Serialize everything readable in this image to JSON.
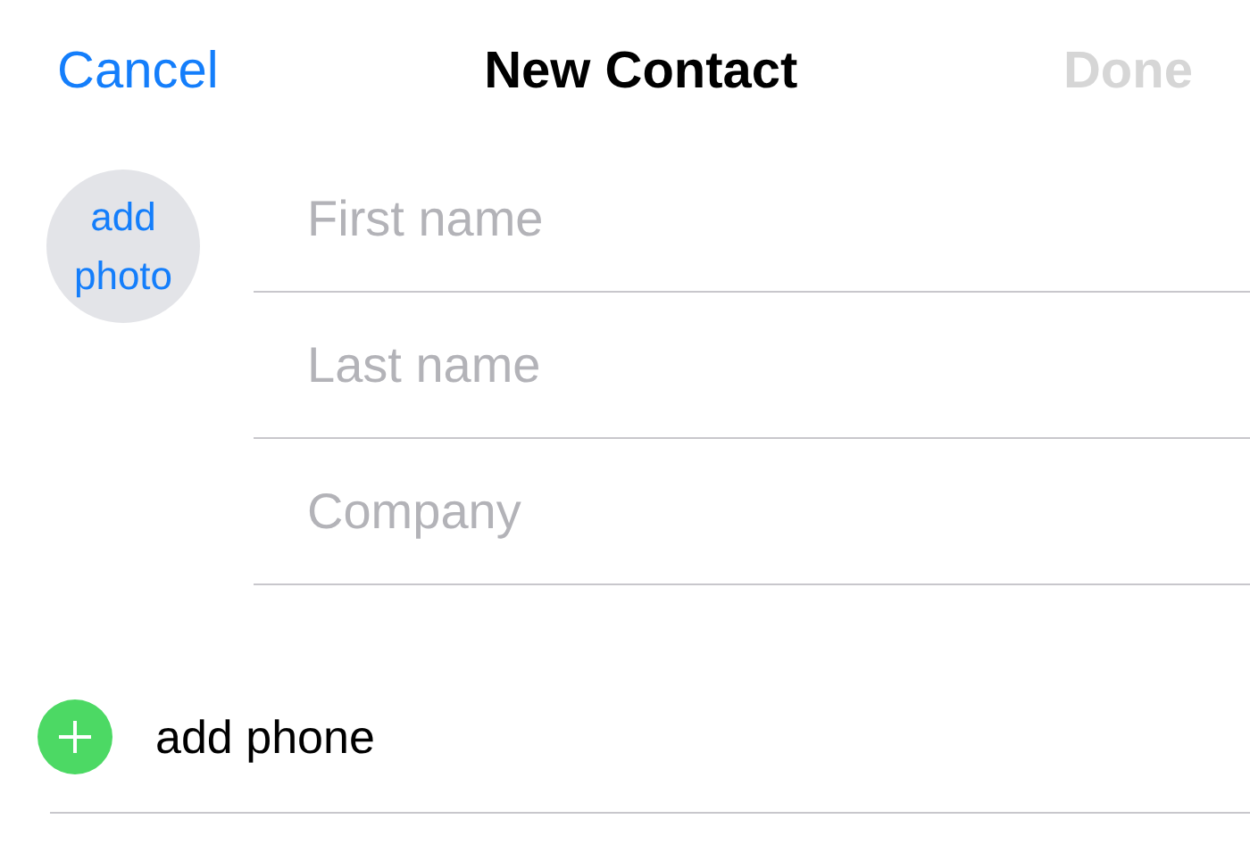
{
  "nav_bar": {
    "cancel": "Cancel",
    "title": "New Contact",
    "done": {
      "label": "Done",
      "disabled": true
    }
  },
  "photo": {
    "label": "add photo"
  },
  "fields": [
    {
      "placeholder": "First name"
    },
    {
      "placeholder": "Last name"
    },
    {
      "placeholder": "Company"
    }
  ],
  "add_phone": {
    "label": "add phone"
  }
}
